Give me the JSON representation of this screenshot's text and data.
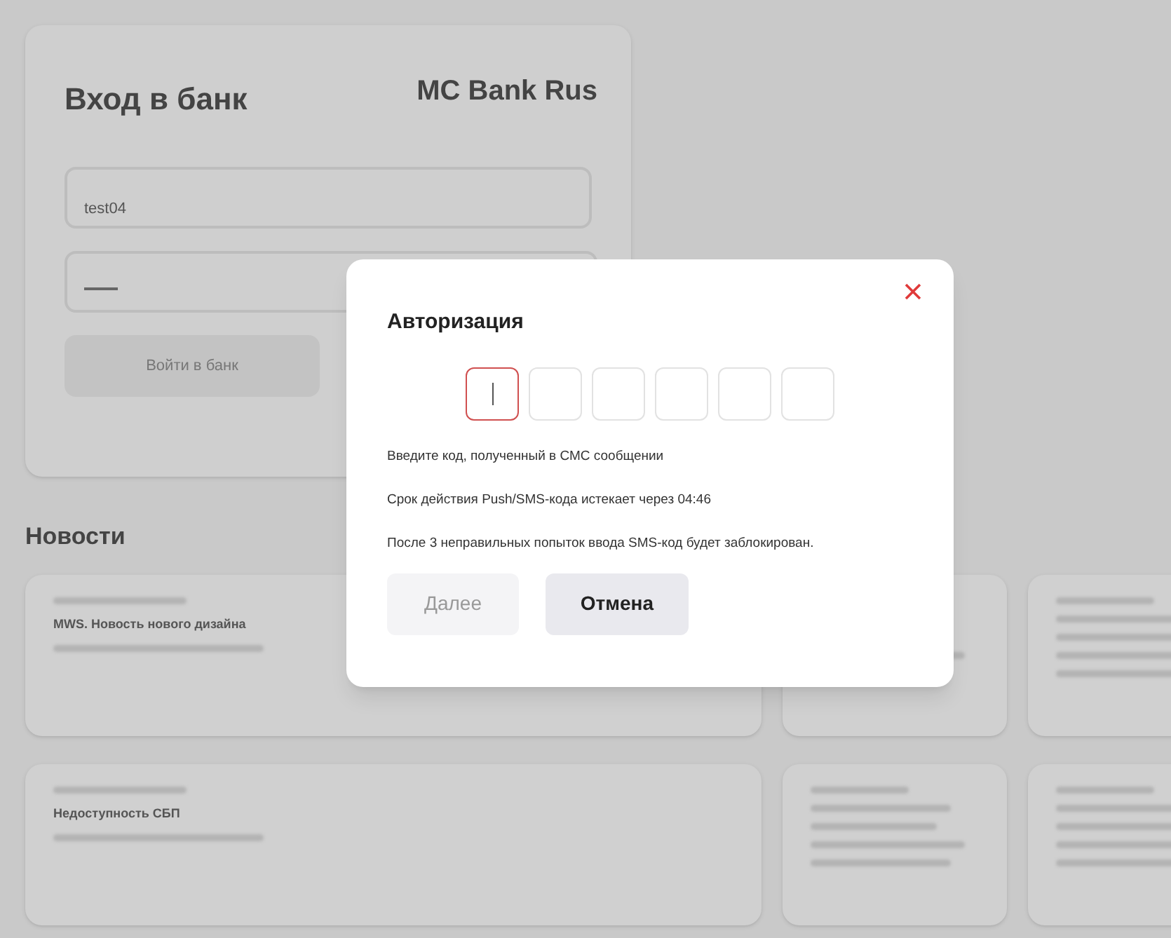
{
  "login_card": {
    "title": "Вход в банк",
    "logo": "MC Bank Rus",
    "login_field": {
      "value": "test04"
    },
    "password_field": {
      "masked": true
    },
    "submit_button": {
      "label": "Войти в банк",
      "disabled": true
    }
  },
  "news": {
    "title": "Новости",
    "cards": [
      {
        "kind": "wide",
        "title": "MWS. Новость нового дизайна"
      },
      {
        "kind": "small"
      },
      {
        "kind": "small"
      },
      {
        "kind": "wide",
        "title": "Недоступность СБП"
      },
      {
        "kind": "small"
      },
      {
        "kind": "small"
      }
    ]
  },
  "dialog": {
    "title": "Авторизация",
    "code_cells": [
      {
        "selected": true
      },
      {
        "selected": false
      },
      {
        "selected": false
      },
      {
        "selected": false
      },
      {
        "selected": false
      },
      {
        "selected": false
      }
    ],
    "messages": [
      "Введите код, полученный в СМС сообщении",
      "Срок действия Push/SMS-кода истекает через 04:46",
      "После 3 неправильных попыток ввода SMS-код будет заблокирован."
    ],
    "buttons": [
      {
        "label": "Далее",
        "disabled": true
      },
      {
        "label": "Отмена",
        "disabled": false
      }
    ]
  }
}
